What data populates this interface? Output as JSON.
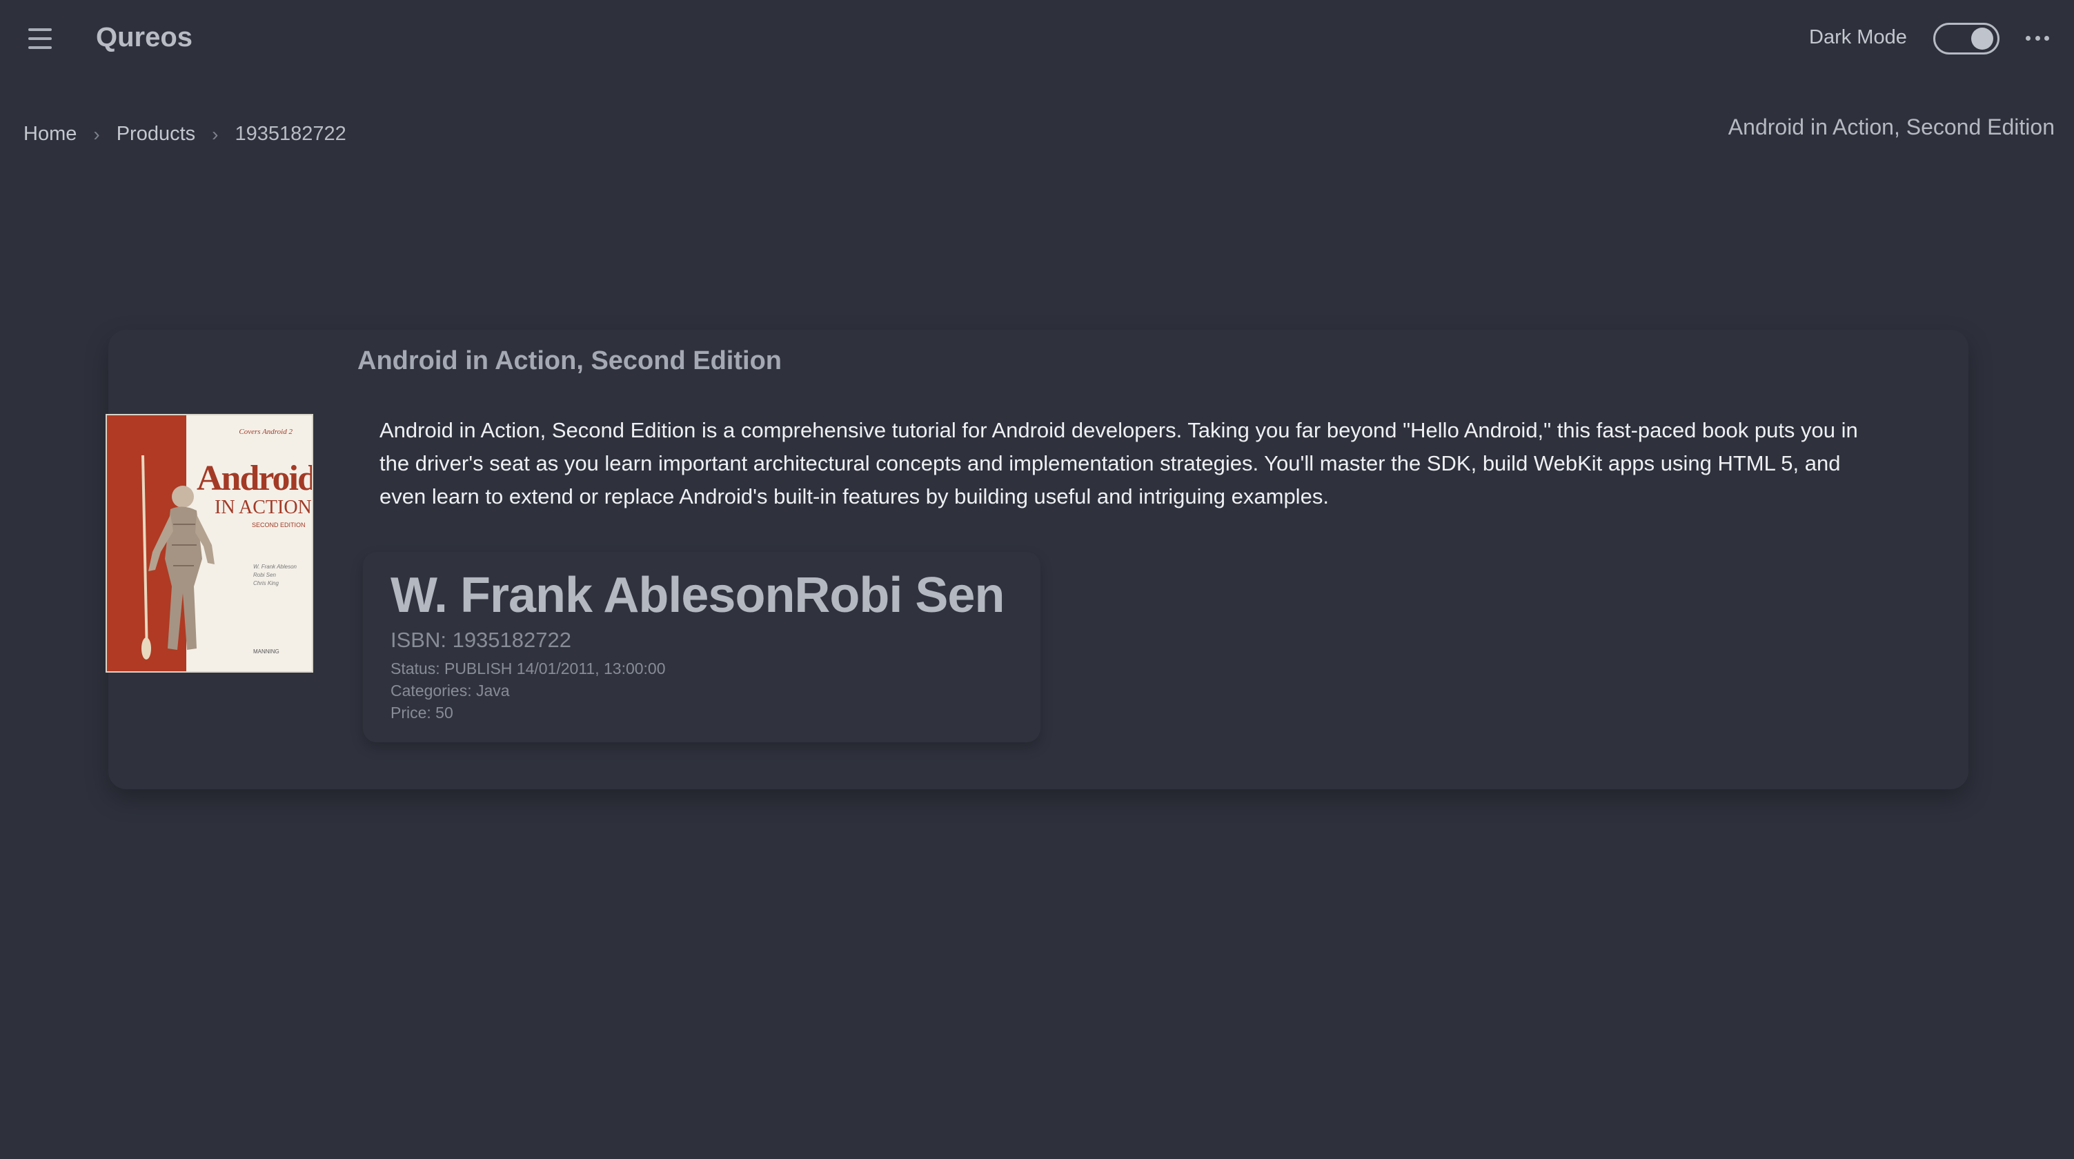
{
  "header": {
    "app_title": "Qureos",
    "dark_mode_label": "Dark Mode",
    "dark_mode_on": true
  },
  "breadcrumb": {
    "items": [
      "Home",
      "Products",
      "1935182722"
    ]
  },
  "page_subtitle": "Android in Action, Second Edition",
  "product": {
    "title": "Android in Action, Second Edition",
    "cover": {
      "series": "Covers Android 2",
      "title": "Android",
      "subtitle": "IN ACTION",
      "edition": "SECOND EDITION",
      "authors": [
        "W. Frank Ableson",
        "Robi Sen",
        "Chris King"
      ],
      "publisher": "MANNING"
    },
    "description": "Android in Action, Second Edition is a comprehensive tutorial for Android developers. Taking you far beyond \"Hello Android,\" this fast-paced book puts you in the driver's seat as you learn important architectural concepts and implementation strategies. You'll master the SDK, build WebKit apps using HTML 5, and even learn to extend or replace Android's built-in features by building useful and intriguing examples.",
    "authors": "W. Frank AblesonRobi Sen",
    "isbn": "ISBN: 1935182722",
    "status": "Status: PUBLISH 14/01/2011, 13:00:00",
    "categories": "Categories: Java",
    "price": "Price: 50"
  },
  "colors": {
    "background": "#2e313c",
    "cover_red": "#b03a23"
  }
}
